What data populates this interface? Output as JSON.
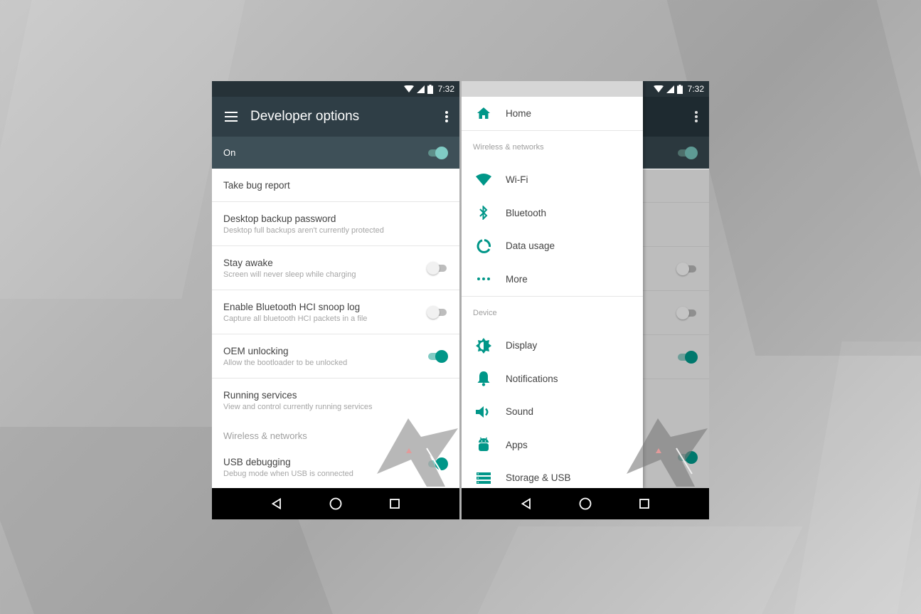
{
  "status_bar": {
    "time": "7:32"
  },
  "left_screen": {
    "toolbar": {
      "title": "Developer options"
    },
    "master_switch": {
      "label": "On",
      "state": "on"
    },
    "items": [
      {
        "title": "Take bug report",
        "summary": null,
        "switch": null
      },
      {
        "title": "Desktop backup password",
        "summary": "Desktop full backups aren't currently protected",
        "switch": null
      },
      {
        "title": "Stay awake",
        "summary": "Screen will never sleep while charging",
        "switch": "off"
      },
      {
        "title": "Enable Bluetooth HCI snoop log",
        "summary": "Capture all bluetooth HCI packets in a file",
        "switch": "off"
      },
      {
        "title": "OEM unlocking",
        "summary": "Allow the bootloader to be unlocked",
        "switch": "on"
      },
      {
        "title": "Running services",
        "summary": "View and control currently running services",
        "switch": null
      }
    ],
    "category": "Wireless & networks",
    "usb_item": {
      "title": "USB debugging",
      "summary": "Debug mode when USB is connected",
      "switch": "on"
    }
  },
  "right_screen": {
    "drawer": {
      "home": {
        "label": "Home",
        "icon": "home-icon"
      },
      "sections": [
        {
          "header": "Wireless & networks",
          "items": [
            {
              "label": "Wi-Fi",
              "icon": "wifi-icon"
            },
            {
              "label": "Bluetooth",
              "icon": "bluetooth-icon"
            },
            {
              "label": "Data usage",
              "icon": "data-usage-icon"
            },
            {
              "label": "More",
              "icon": "more-horiz-icon"
            }
          ]
        },
        {
          "header": "Device",
          "items": [
            {
              "label": "Display",
              "icon": "brightness-icon"
            },
            {
              "label": "Notifications",
              "icon": "bell-icon"
            },
            {
              "label": "Sound",
              "icon": "volume-icon"
            },
            {
              "label": "Apps",
              "icon": "android-icon"
            },
            {
              "label": "Storage & USB",
              "icon": "storage-icon"
            }
          ]
        }
      ]
    }
  },
  "colors": {
    "accent": "#009688",
    "toolbar": "#2f3e46",
    "status_bar": "#263238",
    "master_bar": "#3e5058"
  }
}
